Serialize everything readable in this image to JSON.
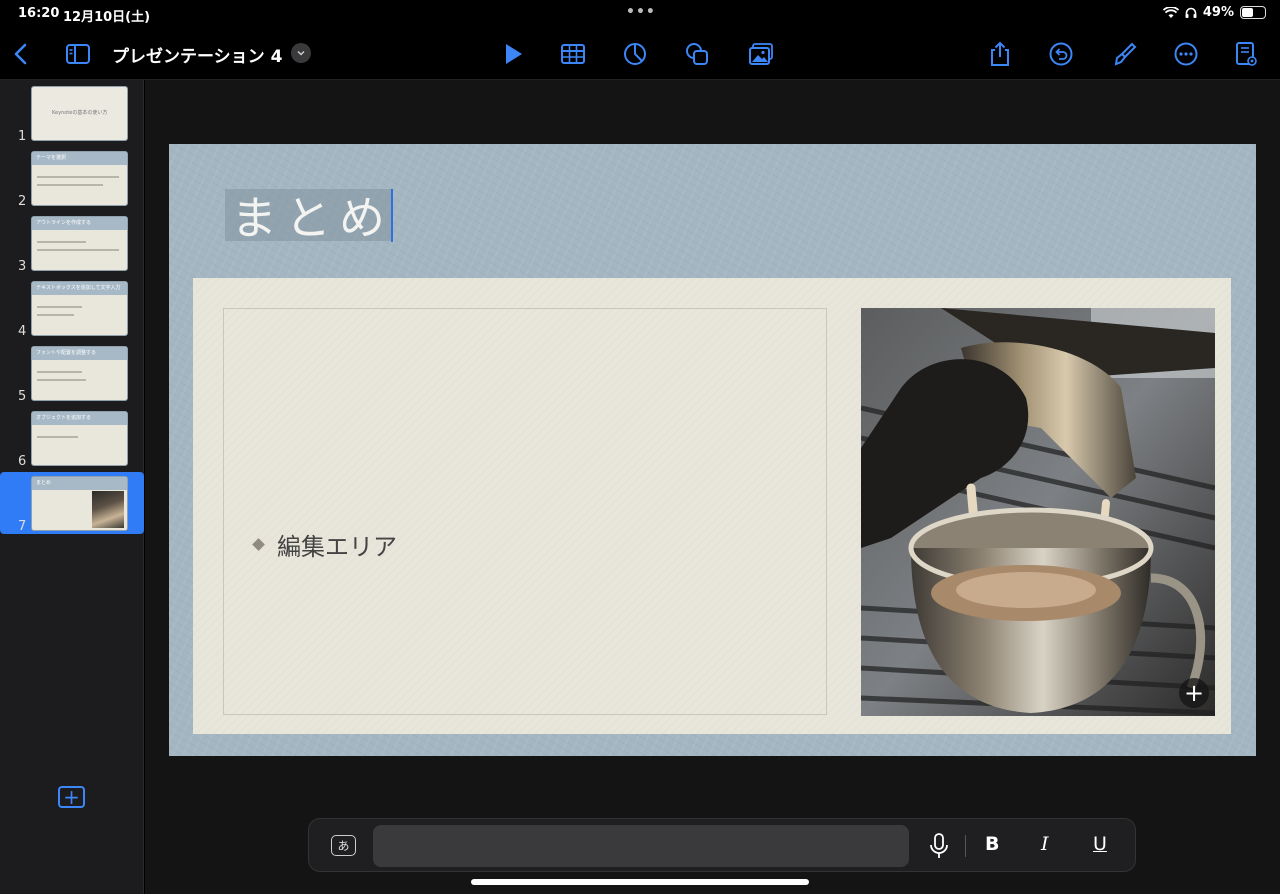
{
  "status": {
    "time": "16:20",
    "date": "12月10日(土)",
    "battery": "49%",
    "battery_level": 0.49
  },
  "toolbar": {
    "title": "プレゼンテーション 4",
    "accent": "#2f7cf6"
  },
  "slides": [
    {
      "number": "1",
      "title": "Keynoteの基本の使い方"
    },
    {
      "number": "2",
      "title": "テーマを選択"
    },
    {
      "number": "3",
      "title": "アウトラインを作成する"
    },
    {
      "number": "4",
      "title": "テキストボックスを追加して文字入力"
    },
    {
      "number": "5",
      "title": "フォントや配置を調整する"
    },
    {
      "number": "6",
      "title": "オブジェクトを追加する"
    },
    {
      "number": "7",
      "title": "まとめ",
      "selected": true
    }
  ],
  "slide": {
    "title": "まとめ",
    "bullet": "編集エリア"
  },
  "keyboard": {
    "lang_key": "あ",
    "bold": "B",
    "italic": "I",
    "underline": "U"
  }
}
